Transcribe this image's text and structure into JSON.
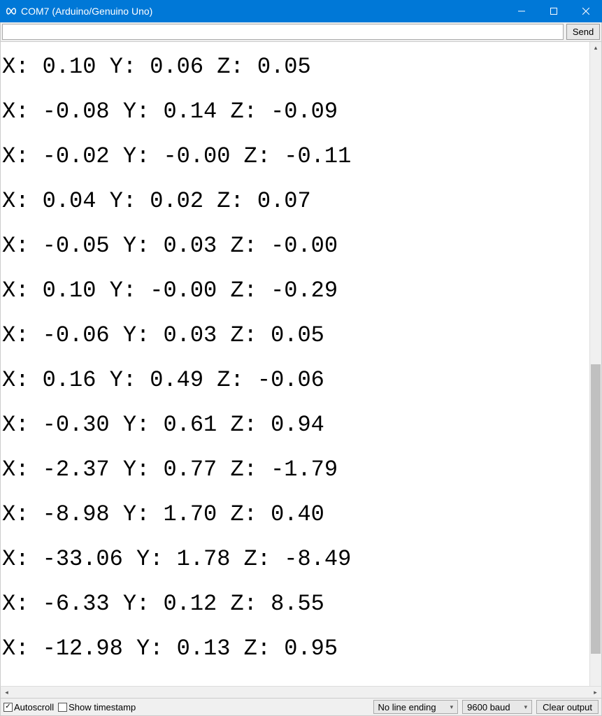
{
  "window": {
    "title": "COM7 (Arduino/Genuino Uno)"
  },
  "input": {
    "value": "",
    "send_label": "Send"
  },
  "output_lines": [
    "X: 0.10 Y: 0.06 Z: 0.05",
    "X: -0.08 Y: 0.14 Z: -0.09",
    "X: -0.02 Y: -0.00 Z: -0.11",
    "X: 0.04 Y: 0.02 Z: 0.07",
    "X: -0.05 Y: 0.03 Z: -0.00",
    "X: 0.10 Y: -0.00 Z: -0.29",
    "X: -0.06 Y: 0.03 Z: 0.05",
    "X: 0.16 Y: 0.49 Z: -0.06",
    "X: -0.30 Y: 0.61 Z: 0.94",
    "X: -2.37 Y: 0.77 Z: -1.79",
    "X: -8.98 Y: 1.70 Z: 0.40",
    "X: -33.06 Y: 1.78 Z: -8.49",
    "X: -6.33 Y: 0.12 Z: 8.55",
    "X: -12.98 Y: 0.13 Z: 0.95"
  ],
  "footer": {
    "autoscroll_label": "Autoscroll",
    "autoscroll_checked": true,
    "timestamp_label": "Show timestamp",
    "timestamp_checked": false,
    "line_ending": "No line ending",
    "baud_rate": "9600 baud",
    "clear_label": "Clear output"
  }
}
